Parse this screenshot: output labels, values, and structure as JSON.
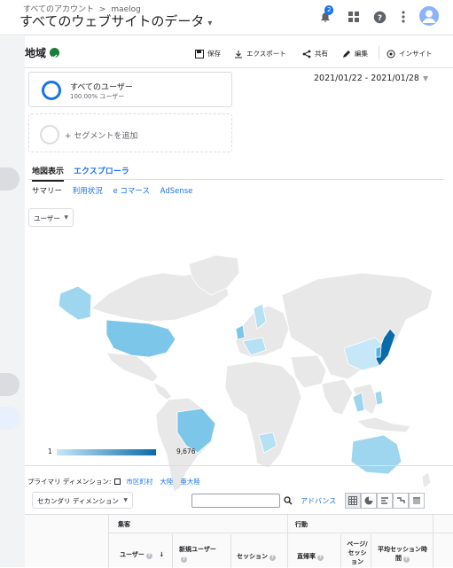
{
  "topbar": {
    "breadcrumb_root": "すべてのアカウント",
    "breadcrumb_sep": ">",
    "breadcrumb_account": "maelog",
    "view_title": "すべてのウェブサイトのデータ",
    "notifications_count": "2"
  },
  "header": {
    "title": "地域",
    "actions": {
      "save": "保存",
      "export": "エクスポート",
      "share": "共有",
      "edit": "編集",
      "insight": "インサイト"
    }
  },
  "segments": {
    "active_name": "すべてのユーザー",
    "active_sub": "100.00% ユーザー",
    "add_label": "+ セグメントを追加"
  },
  "date_range": "2021/01/22 - 2021/01/28",
  "tabs": [
    "地図表示",
    "エクスプローラ"
  ],
  "subtabs": [
    "サマリー",
    "利用状況",
    "e コマース",
    "AdSense"
  ],
  "metric_select": "ユーザー",
  "map_legend": {
    "min": "1",
    "max": "9,676"
  },
  "colors": {
    "accent": "#1a73e8",
    "map_low": "#c6e7f7",
    "map_high": "#0b6aa8",
    "map_empty": "#e8e8e8"
  },
  "dimensions": {
    "label": "プライマリ ディメンション:",
    "items": [
      "市区町村",
      "大陸",
      "亜大陸"
    ],
    "secondary": "セカンダリ ディメンション",
    "advanced": "アドバンス"
  },
  "table": {
    "groups": [
      "集客",
      "行動"
    ],
    "columns": [
      "ユーザー",
      "新規ユーザー",
      "セッション",
      "直帰率",
      "ページ/セッション",
      "平均セッション時間"
    ]
  }
}
